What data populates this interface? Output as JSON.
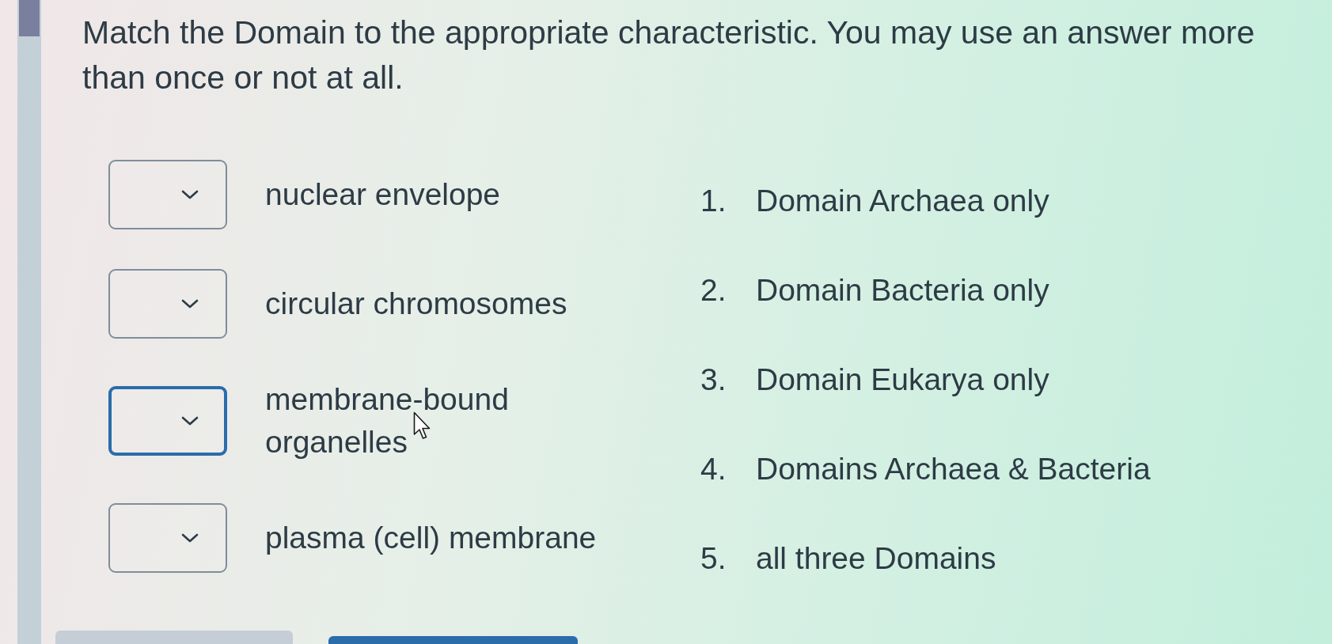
{
  "question": {
    "prompt": "Match the Domain to the appropriate characteristic. You may use an answer more than once or not at all."
  },
  "matches": [
    {
      "characteristic": "nuclear envelope",
      "focused": false,
      "pointer_over": false
    },
    {
      "characteristic": "circular chromosomes",
      "focused": false,
      "pointer_over": false
    },
    {
      "characteristic": "membrane-bound organelles",
      "focused": true,
      "pointer_over": true
    },
    {
      "characteristic": "plasma (cell) membrane",
      "focused": false,
      "pointer_over": false
    }
  ],
  "answers": [
    {
      "number": "1.",
      "text": "Domain Archaea only"
    },
    {
      "number": "2.",
      "text": "Domain Bacteria only"
    },
    {
      "number": "3.",
      "text": "Domain Eukarya only"
    },
    {
      "number": "4.",
      "text": "Domains Archaea & Bacteria"
    },
    {
      "number": "5.",
      "text": "all three Domains"
    }
  ],
  "buttons": [
    {
      "kind": "secondary"
    },
    {
      "kind": "primary"
    }
  ]
}
